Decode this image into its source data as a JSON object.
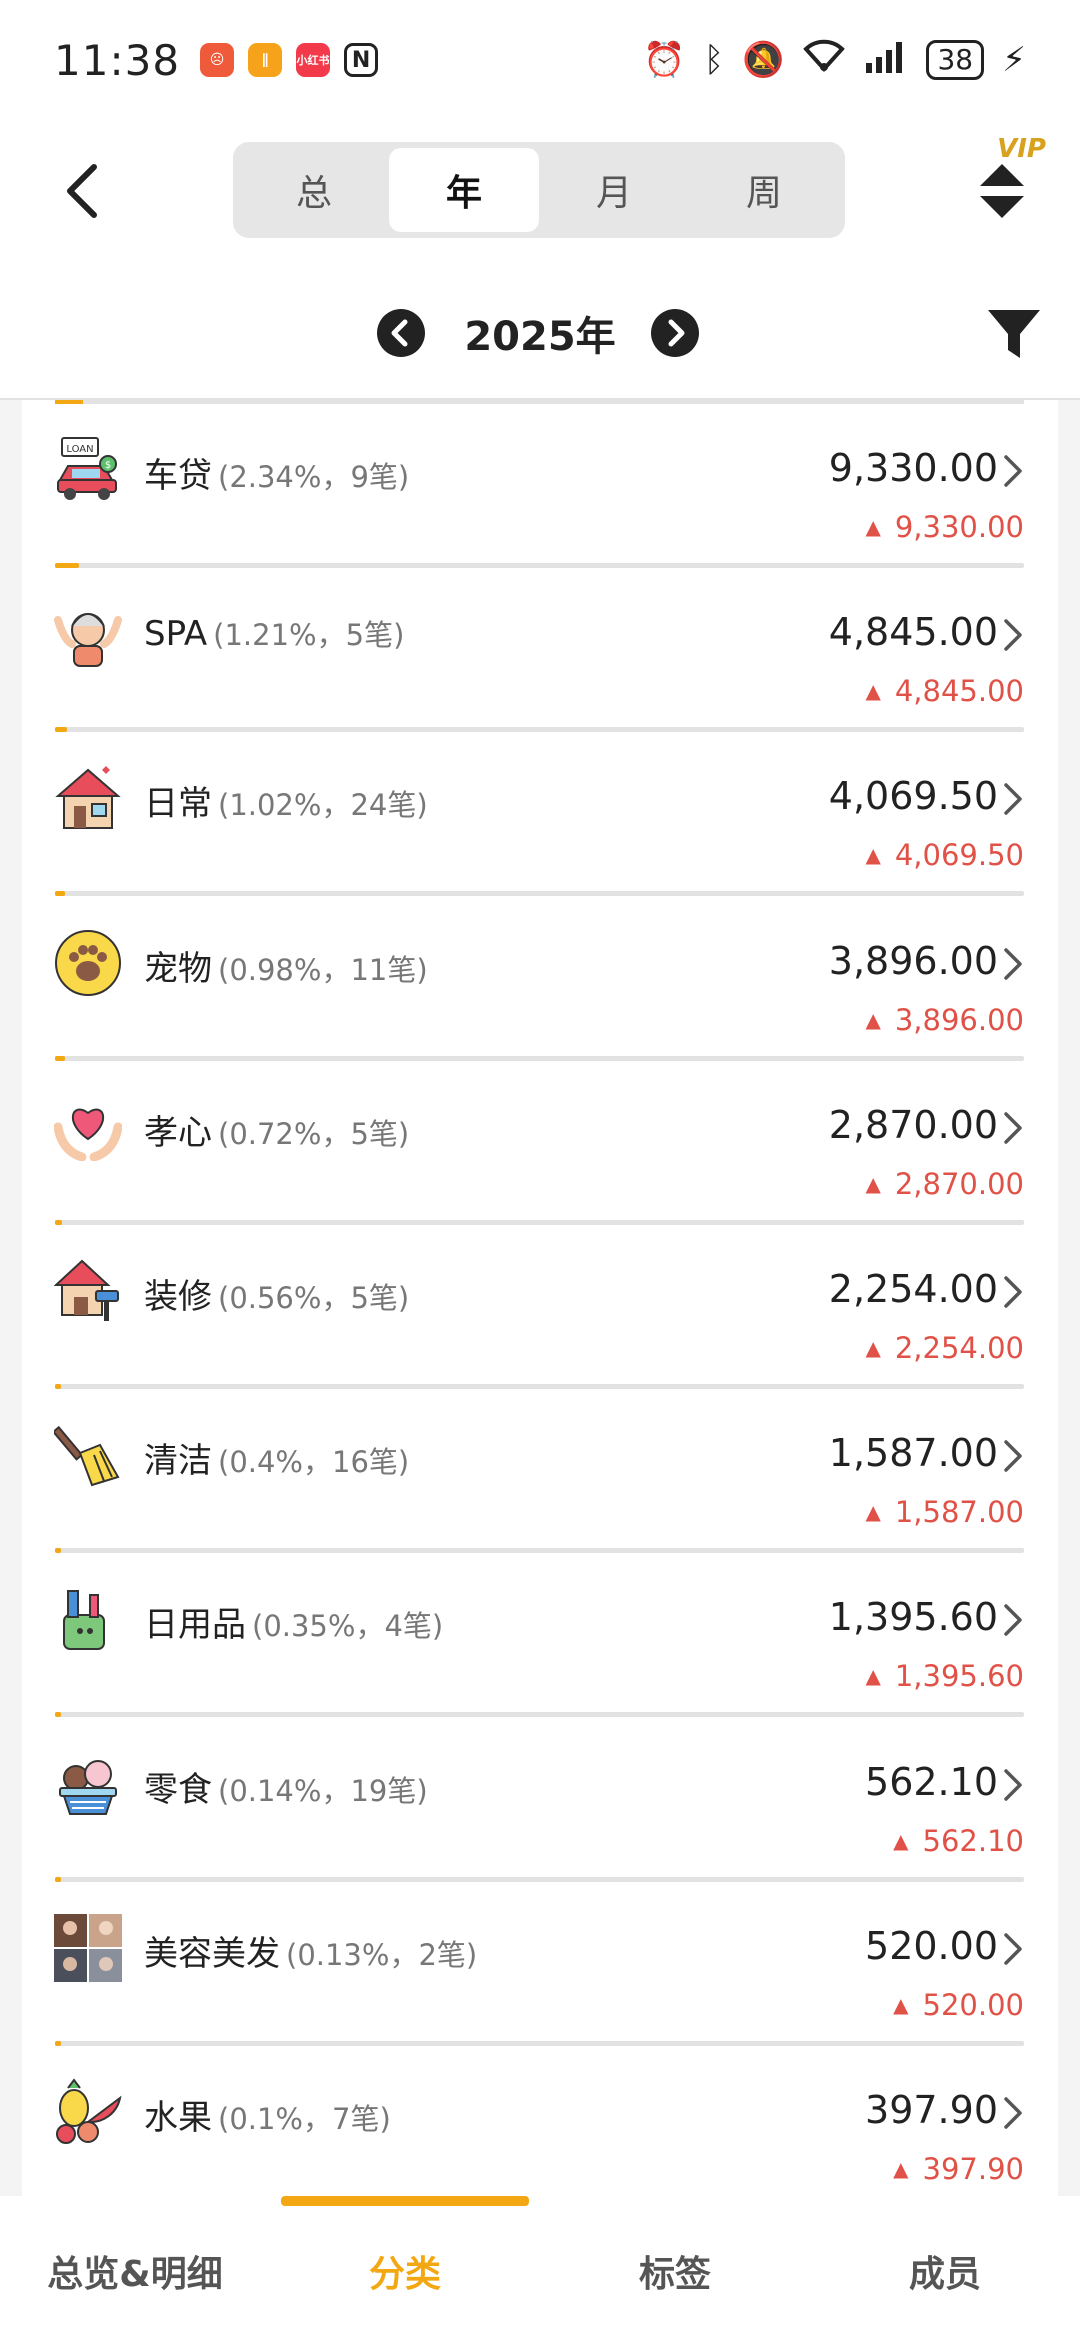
{
  "status_bar": {
    "time": "11:38",
    "battery": "38",
    "apps": [
      {
        "icon": "app-red-icon",
        "color": "#ef5b3a",
        "text": "☹"
      },
      {
        "icon": "app-orange-icon",
        "color": "#f7a21b",
        "text": "∥"
      },
      {
        "icon": "xiaohongshu-icon",
        "color": "#f23a4b",
        "text": "小红书"
      },
      {
        "icon": "nfc-icon",
        "color": "#ffffff",
        "text": "N"
      }
    ]
  },
  "header": {
    "segments": [
      {
        "label": "总",
        "active": false
      },
      {
        "label": "年",
        "active": true
      },
      {
        "label": "月",
        "active": false
      },
      {
        "label": "周",
        "active": false
      }
    ],
    "vip_label": "VIP"
  },
  "period": {
    "label": "2025年"
  },
  "categories": [
    {
      "name": "车贷",
      "meta": "(2.34%，9笔)",
      "amount": "9,330.00",
      "change": "9,330.00",
      "share_percent": 2.34,
      "icon": "car-loan-icon"
    },
    {
      "name": "SPA",
      "meta": "(1.21%，5笔)",
      "amount": "4,845.00",
      "change": "4,845.00",
      "share_percent": 1.21,
      "icon": "spa-icon"
    },
    {
      "name": "日常",
      "meta": "(1.02%，24笔)",
      "amount": "4,069.50",
      "change": "4,069.50",
      "share_percent": 1.02,
      "icon": "house-icon"
    },
    {
      "name": "宠物",
      "meta": "(0.98%，11笔)",
      "amount": "3,896.00",
      "change": "3,896.00",
      "share_percent": 0.98,
      "icon": "paw-icon"
    },
    {
      "name": "孝心",
      "meta": "(0.72%，5笔)",
      "amount": "2,870.00",
      "change": "2,870.00",
      "share_percent": 0.72,
      "icon": "heart-hands-icon"
    },
    {
      "name": "装修",
      "meta": "(0.56%，5笔)",
      "amount": "2,254.00",
      "change": "2,254.00",
      "share_percent": 0.56,
      "icon": "renovation-icon"
    },
    {
      "name": "清洁",
      "meta": "(0.4%，16笔)",
      "amount": "1,587.00",
      "change": "1,587.00",
      "share_percent": 0.4,
      "icon": "broom-icon"
    },
    {
      "name": "日用品",
      "meta": "(0.35%，4笔)",
      "amount": "1,395.60",
      "change": "1,395.60",
      "share_percent": 0.35,
      "icon": "toiletries-icon"
    },
    {
      "name": "零食",
      "meta": "(0.14%，19笔)",
      "amount": "562.10",
      "change": "562.10",
      "share_percent": 0.14,
      "icon": "ice-cream-icon"
    },
    {
      "name": "美容美发",
      "meta": "(0.13%，2笔)",
      "amount": "520.00",
      "change": "520.00",
      "share_percent": 0.13,
      "icon": "beauty-photo-icon"
    },
    {
      "name": "水果",
      "meta": "(0.1%，7笔)",
      "amount": "397.90",
      "change": "397.90",
      "share_percent": 0.1,
      "icon": "fruit-icon"
    }
  ],
  "bottom_nav": [
    {
      "label": "总览&明细",
      "active": false
    },
    {
      "label": "分类",
      "active": true
    },
    {
      "label": "标签",
      "active": false
    },
    {
      "label": "成员",
      "active": false
    }
  ],
  "colors": {
    "accent": "#f3a712",
    "increase": "#e05247",
    "segment_bg": "#e6e6e6"
  }
}
